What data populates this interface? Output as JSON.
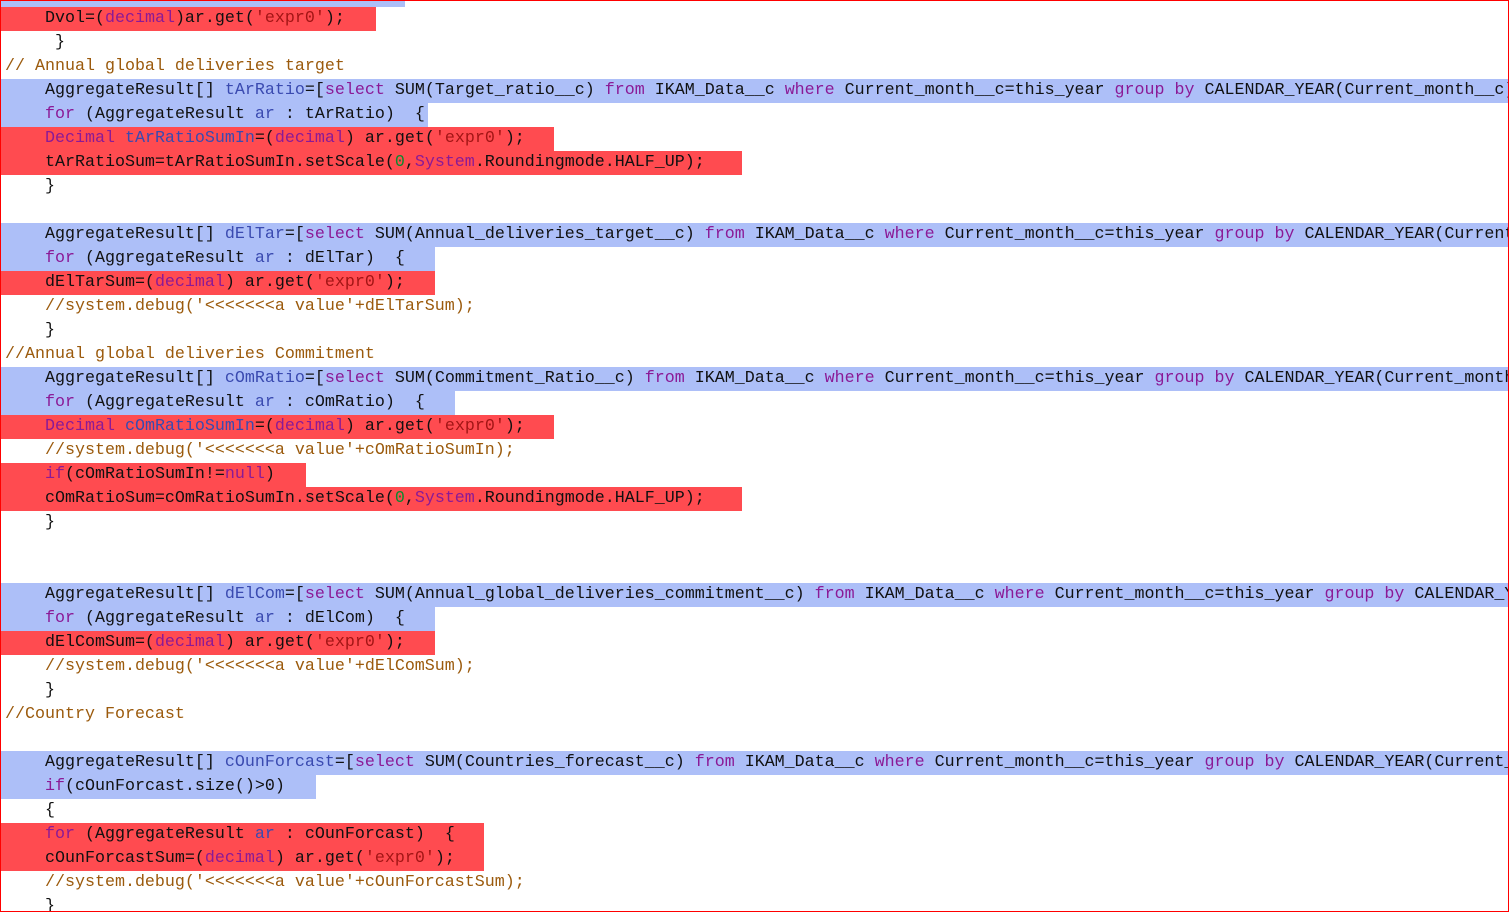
{
  "editor": {
    "lines": [
      {
        "hl": "blue",
        "tokens": []
      },
      {
        "hl": "red",
        "tokens": [
          [
            "    Dvol=(",
            "p"
          ],
          [
            "decimal",
            "k"
          ],
          [
            ")ar.get(",
            "p"
          ],
          [
            "'expr0'",
            "s"
          ],
          [
            ");",
            "p"
          ]
        ]
      },
      {
        "hl": null,
        "tokens": [
          [
            "     }",
            "p"
          ]
        ]
      },
      {
        "hl": null,
        "tokens": [
          [
            "// Annual global deliveries target",
            "c"
          ]
        ]
      },
      {
        "hl": "blue",
        "tokens": [
          [
            "    AggregateResult[] ",
            "p"
          ],
          [
            "tArRatio",
            "v"
          ],
          [
            "=[",
            "p"
          ],
          [
            "select",
            "k"
          ],
          [
            " SUM(Target_ratio__c) ",
            "p"
          ],
          [
            "from",
            "k"
          ],
          [
            " IKAM_Data__c ",
            "p"
          ],
          [
            "where",
            "k"
          ],
          [
            " Current_month__c=this_year ",
            "p"
          ],
          [
            "group by",
            "k"
          ],
          [
            " CALENDAR_YEAR(Current_month__c)]",
            "p"
          ]
        ]
      },
      {
        "hl": "blue",
        "tokens": [
          [
            "    ",
            "p"
          ],
          [
            "for",
            "k"
          ],
          [
            " (AggregateResult ",
            "p"
          ],
          [
            "ar",
            "v"
          ],
          [
            " : tArRatio)  {",
            "p"
          ]
        ]
      },
      {
        "hl": "red",
        "tokens": [
          [
            "    ",
            "p"
          ],
          [
            "Decimal",
            "k"
          ],
          [
            " ",
            "p"
          ],
          [
            "tArRatioSumIn",
            "v"
          ],
          [
            "=(",
            "p"
          ],
          [
            "decimal",
            "k"
          ],
          [
            ") ar.get(",
            "p"
          ],
          [
            "'expr0'",
            "s"
          ],
          [
            ");",
            "p"
          ]
        ]
      },
      {
        "hl": "red",
        "tokens": [
          [
            "    tArRatioSum=tArRatioSumIn.setScale(",
            "p"
          ],
          [
            "0",
            "n"
          ],
          [
            ",",
            "p"
          ],
          [
            "System",
            "k"
          ],
          [
            ".Roundingmode.HALF_UP);",
            "p"
          ]
        ]
      },
      {
        "hl": null,
        "tokens": [
          [
            "    }",
            "p"
          ]
        ]
      },
      {
        "hl": null,
        "tokens": []
      },
      {
        "hl": "blue",
        "tokens": [
          [
            "    AggregateResult[] ",
            "p"
          ],
          [
            "dElTar",
            "v"
          ],
          [
            "=[",
            "p"
          ],
          [
            "select",
            "k"
          ],
          [
            " SUM(Annual_deliveries_target__c) ",
            "p"
          ],
          [
            "from",
            "k"
          ],
          [
            " IKAM_Data__c ",
            "p"
          ],
          [
            "where",
            "k"
          ],
          [
            " Current_month__c=this_year ",
            "p"
          ],
          [
            "group by",
            "k"
          ],
          [
            " CALENDAR_YEAR(Current_",
            "p"
          ]
        ]
      },
      {
        "hl": "blue",
        "tokens": [
          [
            "    ",
            "p"
          ],
          [
            "for",
            "k"
          ],
          [
            " (AggregateResult ",
            "p"
          ],
          [
            "ar",
            "v"
          ],
          [
            " : dElTar)  {",
            "p"
          ]
        ]
      },
      {
        "hl": "red",
        "tokens": [
          [
            "    dElTarSum=(",
            "p"
          ],
          [
            "decimal",
            "k"
          ],
          [
            ") ar.get(",
            "p"
          ],
          [
            "'expr0'",
            "s"
          ],
          [
            ");",
            "p"
          ]
        ]
      },
      {
        "hl": null,
        "tokens": [
          [
            "    //system.debug('<<<<<<<a value'+dElTarSum);",
            "c"
          ]
        ]
      },
      {
        "hl": null,
        "tokens": [
          [
            "    }",
            "p"
          ]
        ]
      },
      {
        "hl": null,
        "tokens": [
          [
            "//Annual global deliveries Commitment",
            "c"
          ]
        ]
      },
      {
        "hl": "blue",
        "tokens": [
          [
            "    AggregateResult[] ",
            "p"
          ],
          [
            "cOmRatio",
            "v"
          ],
          [
            "=[",
            "p"
          ],
          [
            "select",
            "k"
          ],
          [
            " SUM(Commitment_Ratio__c) ",
            "p"
          ],
          [
            "from",
            "k"
          ],
          [
            " IKAM_Data__c ",
            "p"
          ],
          [
            "where",
            "k"
          ],
          [
            " Current_month__c=this_year ",
            "p"
          ],
          [
            "group by",
            "k"
          ],
          [
            " CALENDAR_YEAR(Current_month_",
            "p"
          ]
        ]
      },
      {
        "hl": "blue",
        "tokens": [
          [
            "    ",
            "p"
          ],
          [
            "for",
            "k"
          ],
          [
            " (AggregateResult ",
            "p"
          ],
          [
            "ar",
            "v"
          ],
          [
            " : cOmRatio)  {",
            "p"
          ]
        ]
      },
      {
        "hl": "red",
        "tokens": [
          [
            "    ",
            "p"
          ],
          [
            "Decimal",
            "k"
          ],
          [
            " ",
            "p"
          ],
          [
            "cOmRatioSumIn",
            "v"
          ],
          [
            "=(",
            "p"
          ],
          [
            "decimal",
            "k"
          ],
          [
            ") ar.get(",
            "p"
          ],
          [
            "'expr0'",
            "s"
          ],
          [
            ");",
            "p"
          ]
        ]
      },
      {
        "hl": null,
        "tokens": [
          [
            "    //system.debug('<<<<<<<a value'+cOmRatioSumIn);",
            "c"
          ]
        ]
      },
      {
        "hl": "red",
        "tokens": [
          [
            "    ",
            "p"
          ],
          [
            "if",
            "k"
          ],
          [
            "(cOmRatioSumIn!=",
            "p"
          ],
          [
            "null",
            "k"
          ],
          [
            ")",
            "p"
          ]
        ]
      },
      {
        "hl": "red",
        "tokens": [
          [
            "    cOmRatioSum=cOmRatioSumIn.setScale(",
            "p"
          ],
          [
            "0",
            "n"
          ],
          [
            ",",
            "p"
          ],
          [
            "System",
            "k"
          ],
          [
            ".Roundingmode.HALF_UP);",
            "p"
          ]
        ]
      },
      {
        "hl": null,
        "tokens": [
          [
            "    }",
            "p"
          ]
        ]
      },
      {
        "hl": null,
        "tokens": []
      },
      {
        "hl": null,
        "tokens": []
      },
      {
        "hl": "blue",
        "tokens": [
          [
            "    AggregateResult[] ",
            "p"
          ],
          [
            "dElCom",
            "v"
          ],
          [
            "=[",
            "p"
          ],
          [
            "select",
            "k"
          ],
          [
            " SUM(Annual_global_deliveries_commitment__c) ",
            "p"
          ],
          [
            "from",
            "k"
          ],
          [
            " IKAM_Data__c ",
            "p"
          ],
          [
            "where",
            "k"
          ],
          [
            " Current_month__c=this_year ",
            "p"
          ],
          [
            "group by",
            "k"
          ],
          [
            " CALENDAR_YE",
            "p"
          ]
        ]
      },
      {
        "hl": "blue",
        "tokens": [
          [
            "    ",
            "p"
          ],
          [
            "for",
            "k"
          ],
          [
            " (AggregateResult ",
            "p"
          ],
          [
            "ar",
            "v"
          ],
          [
            " : dElCom)  {",
            "p"
          ]
        ]
      },
      {
        "hl": "red",
        "tokens": [
          [
            "    dElComSum=(",
            "p"
          ],
          [
            "decimal",
            "k"
          ],
          [
            ") ar.get(",
            "p"
          ],
          [
            "'expr0'",
            "s"
          ],
          [
            ");",
            "p"
          ]
        ]
      },
      {
        "hl": null,
        "tokens": [
          [
            "    //system.debug('<<<<<<<a value'+dElComSum);",
            "c"
          ]
        ]
      },
      {
        "hl": null,
        "tokens": [
          [
            "    }",
            "p"
          ]
        ]
      },
      {
        "hl": null,
        "tokens": [
          [
            "//Country Forecast",
            "c"
          ]
        ]
      },
      {
        "hl": null,
        "tokens": []
      },
      {
        "hl": "blue",
        "tokens": [
          [
            "    AggregateResult[] ",
            "p"
          ],
          [
            "cOunForcast",
            "v"
          ],
          [
            "=[",
            "p"
          ],
          [
            "select",
            "k"
          ],
          [
            " SUM(Countries_forecast__c) ",
            "p"
          ],
          [
            "from",
            "k"
          ],
          [
            " IKAM_Data__c ",
            "p"
          ],
          [
            "where",
            "k"
          ],
          [
            " Current_month__c=this_year ",
            "p"
          ],
          [
            "group by",
            "k"
          ],
          [
            " CALENDAR_YEAR(Current_m",
            "p"
          ]
        ]
      },
      {
        "hl": "blue",
        "tokens": [
          [
            "    ",
            "p"
          ],
          [
            "if",
            "k"
          ],
          [
            "(cOunForcast.size()>0)",
            "p"
          ]
        ]
      },
      {
        "hl": null,
        "tokens": [
          [
            "    {",
            "p"
          ]
        ]
      },
      {
        "hl": "red",
        "tokens": [
          [
            "    ",
            "p"
          ],
          [
            "for",
            "k"
          ],
          [
            " (AggregateResult ",
            "p"
          ],
          [
            "ar",
            "v"
          ],
          [
            " : cOunForcast)  {",
            "p"
          ]
        ]
      },
      {
        "hl": "red",
        "tokens": [
          [
            "    cOunForcastSum=(",
            "p"
          ],
          [
            "decimal",
            "k"
          ],
          [
            ") ar.get(",
            "p"
          ],
          [
            "'expr0'",
            "s"
          ],
          [
            ");",
            "p"
          ]
        ]
      },
      {
        "hl": null,
        "tokens": [
          [
            "    //system.debug('<<<<<<<a value'+cOunForcastSum);",
            "c"
          ]
        ]
      },
      {
        "hl": null,
        "tokens": [
          [
            "    }",
            "p"
          ]
        ]
      }
    ]
  }
}
